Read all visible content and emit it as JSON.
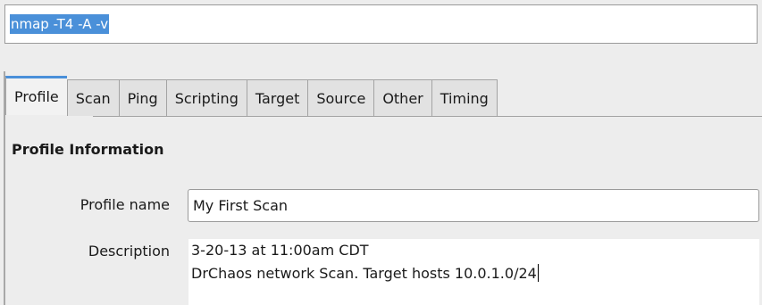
{
  "command": {
    "value": "nmap -T4 -A -v"
  },
  "tabs": [
    {
      "label": "Profile",
      "active": true
    },
    {
      "label": "Scan"
    },
    {
      "label": "Ping"
    },
    {
      "label": "Scripting"
    },
    {
      "label": "Target"
    },
    {
      "label": "Source"
    },
    {
      "label": "Other"
    },
    {
      "label": "Timing"
    }
  ],
  "profile": {
    "section_title": "Profile Information",
    "name_label": "Profile name",
    "name_value": "My First Scan",
    "description_label": "Description",
    "description_lines": [
      "3-20-13 at 11:00am CDT",
      "DrChaos network Scan. Target hosts 10.0.1.0/24"
    ]
  },
  "colors": {
    "selection": "#4a90d9",
    "tab_active_top": "#4a90d9"
  }
}
